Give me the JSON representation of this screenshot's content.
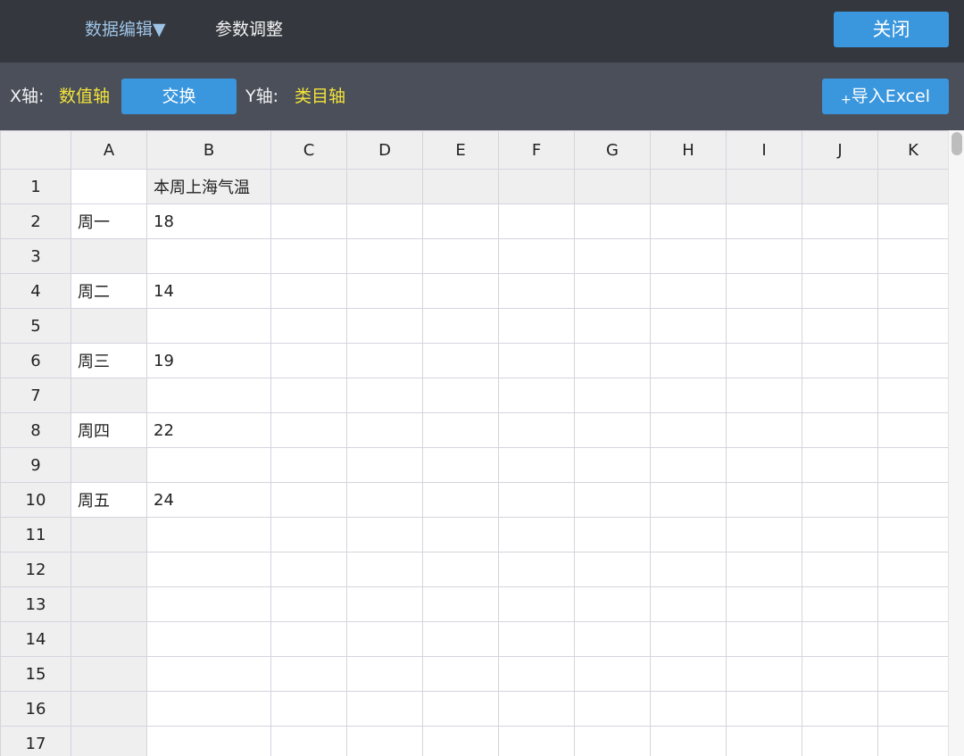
{
  "menu": {
    "data_edit": "数据编辑▼",
    "param_adjust": "参数调整",
    "close": "关闭"
  },
  "toolbar": {
    "x_label": "X轴:",
    "x_value": "数值轴",
    "swap": "交换",
    "y_label": "Y轴:",
    "y_value": "类目轴",
    "import_plus": "+",
    "import_label": "导入Excel"
  },
  "sheet": {
    "columns": [
      "A",
      "B",
      "C",
      "D",
      "E",
      "F",
      "G",
      "H",
      "I",
      "J",
      "K"
    ],
    "rows": [
      {
        "n": "1",
        "cells": [
          "",
          "本周上海气温",
          "",
          "",
          "",
          "",
          "",
          "",
          "",
          "",
          ""
        ]
      },
      {
        "n": "2",
        "cells": [
          "周一",
          "18",
          "",
          "",
          "",
          "",
          "",
          "",
          "",
          "",
          ""
        ]
      },
      {
        "n": "3",
        "cells": [
          "",
          "",
          "",
          "",
          "",
          "",
          "",
          "",
          "",
          "",
          ""
        ]
      },
      {
        "n": "4",
        "cells": [
          "周二",
          "14",
          "",
          "",
          "",
          "",
          "",
          "",
          "",
          "",
          ""
        ]
      },
      {
        "n": "5",
        "cells": [
          "",
          "",
          "",
          "",
          "",
          "",
          "",
          "",
          "",
          "",
          ""
        ]
      },
      {
        "n": "6",
        "cells": [
          "周三",
          "19",
          "",
          "",
          "",
          "",
          "",
          "",
          "",
          "",
          ""
        ]
      },
      {
        "n": "7",
        "cells": [
          "",
          "",
          "",
          "",
          "",
          "",
          "",
          "",
          "",
          "",
          ""
        ]
      },
      {
        "n": "8",
        "cells": [
          "周四",
          "22",
          "",
          "",
          "",
          "",
          "",
          "",
          "",
          "",
          ""
        ]
      },
      {
        "n": "9",
        "cells": [
          "",
          "",
          "",
          "",
          "",
          "",
          "",
          "",
          "",
          "",
          ""
        ]
      },
      {
        "n": "10",
        "cells": [
          "周五",
          "24",
          "",
          "",
          "",
          "",
          "",
          "",
          "",
          "",
          ""
        ]
      },
      {
        "n": "11",
        "cells": [
          "",
          "",
          "",
          "",
          "",
          "",
          "",
          "",
          "",
          "",
          ""
        ]
      },
      {
        "n": "12",
        "cells": [
          "",
          "",
          "",
          "",
          "",
          "",
          "",
          "",
          "",
          "",
          ""
        ]
      },
      {
        "n": "13",
        "cells": [
          "",
          "",
          "",
          "",
          "",
          "",
          "",
          "",
          "",
          "",
          ""
        ]
      },
      {
        "n": "14",
        "cells": [
          "",
          "",
          "",
          "",
          "",
          "",
          "",
          "",
          "",
          "",
          ""
        ]
      },
      {
        "n": "15",
        "cells": [
          "",
          "",
          "",
          "",
          "",
          "",
          "",
          "",
          "",
          "",
          ""
        ]
      },
      {
        "n": "16",
        "cells": [
          "",
          "",
          "",
          "",
          "",
          "",
          "",
          "",
          "",
          "",
          ""
        ]
      },
      {
        "n": "17",
        "cells": [
          "",
          "",
          "",
          "",
          "",
          "",
          "",
          "",
          "",
          "",
          ""
        ]
      }
    ]
  }
}
